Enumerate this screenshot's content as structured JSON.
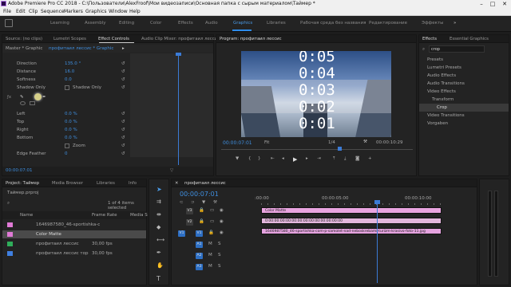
{
  "window": {
    "title": "Adobe Premiere Pro CC 2018 - C:\\Пользователи\\AlexFroof\\Мои видеозаписи\\Основная папка с сырым материалом\\Таймер *",
    "min": "–",
    "max": "□",
    "close": "✕"
  },
  "menu": [
    "File",
    "Edit",
    "Clip",
    "Sequence",
    "Markers",
    "Graphics",
    "Window",
    "Help"
  ],
  "workspaces": [
    "Learning",
    "Assembly",
    "Editing",
    "Color",
    "Effects",
    "Audio",
    "Graphics",
    "Libraries",
    "Рабочая среда без названия",
    "Редактирование",
    "Эффекты"
  ],
  "source_panel": {
    "tabs": [
      "Source: (no clips)",
      "Lumetri Scopes",
      "Effect Controls",
      "Audio Clip Mixer: профитаил лессис"
    ],
    "master": "Master * Graphic",
    "clip": "профитаил лессис * Graphic",
    "props": [
      {
        "label": "Direction",
        "value": "135.0 °"
      },
      {
        "label": "Distance",
        "value": "16.0"
      },
      {
        "label": "Softness",
        "value": "0.0"
      },
      {
        "label": "Shadow Only",
        "value": "Shadow Only"
      }
    ],
    "pads": [
      {
        "label": "Left",
        "value": "0.0 %"
      },
      {
        "label": "Top",
        "value": "0.0 %"
      },
      {
        "label": "Right",
        "value": "0.0 %"
      },
      {
        "label": "Bottom",
        "value": "0.0 %"
      },
      {
        "label": "",
        "value": "Zoom"
      },
      {
        "label": "Edge Feather",
        "value": "0"
      }
    ],
    "timecode": "00:00:07:01"
  },
  "program": {
    "tab": "Program: профитаил лессис",
    "timecode": "00:00:07:01",
    "fit": "Fit",
    "quality": "1/4",
    "duration": "00:00:10:29",
    "digits": [
      "0:05",
      "0:04",
      "0:03",
      "0:02",
      "0:01"
    ]
  },
  "effects_panel": {
    "tabs": [
      "Effects",
      "Essential Graphics"
    ],
    "search": "crop",
    "items": [
      "Presets",
      "Lumetri Presets",
      "Audio Effects",
      "Audio Transitions",
      "Video Effects",
      "Transform",
      "Crop",
      "Video Transitions",
      "Vorgaben"
    ]
  },
  "project": {
    "tabs": [
      "Project: Таймер",
      "Media Browser",
      "Libraries",
      "Info"
    ],
    "file": "Таймер.prproj",
    "count": "1 of 4 items selected",
    "col_name": "Name",
    "col_rate": "Frame Rate",
    "col_media": "Media S",
    "items": [
      {
        "name": "1646987580_46-sportishka-c",
        "rate": "",
        "color": "#e07ad6"
      },
      {
        "name": "Color Matte",
        "rate": "",
        "color": "#e07ad6"
      },
      {
        "name": "профитаил лессис",
        "rate": "30,00 fps",
        "color": "#2fae5a"
      },
      {
        "name": "профитаил лессис тор",
        "rate": "30,00 fps",
        "color": "#3f7fe0"
      }
    ]
  },
  "timeline": {
    "tab": "профитаил лессис",
    "timecode": "00:00:07:01",
    "ruler": [
      ":00:00",
      "00:00:05:00",
      "00:00:10:00"
    ],
    "tracks": [
      "V3",
      "V2",
      "V1",
      "A1",
      "A2",
      "A3"
    ],
    "clips": [
      {
        "label": "Color Matte",
        "color": "#e9a4e0"
      },
      {
        "label": "0:00:00:00:00:00:00:00:00:00:00:00:00:00",
        "color": "#e3b7dd"
      },
      {
        "label": "1646987580_46-sportishka-com-p-samolet-nad-neboskrebami-turizm-krasivo-foto-11.jpg",
        "color": "#e5a3df"
      }
    ]
  }
}
